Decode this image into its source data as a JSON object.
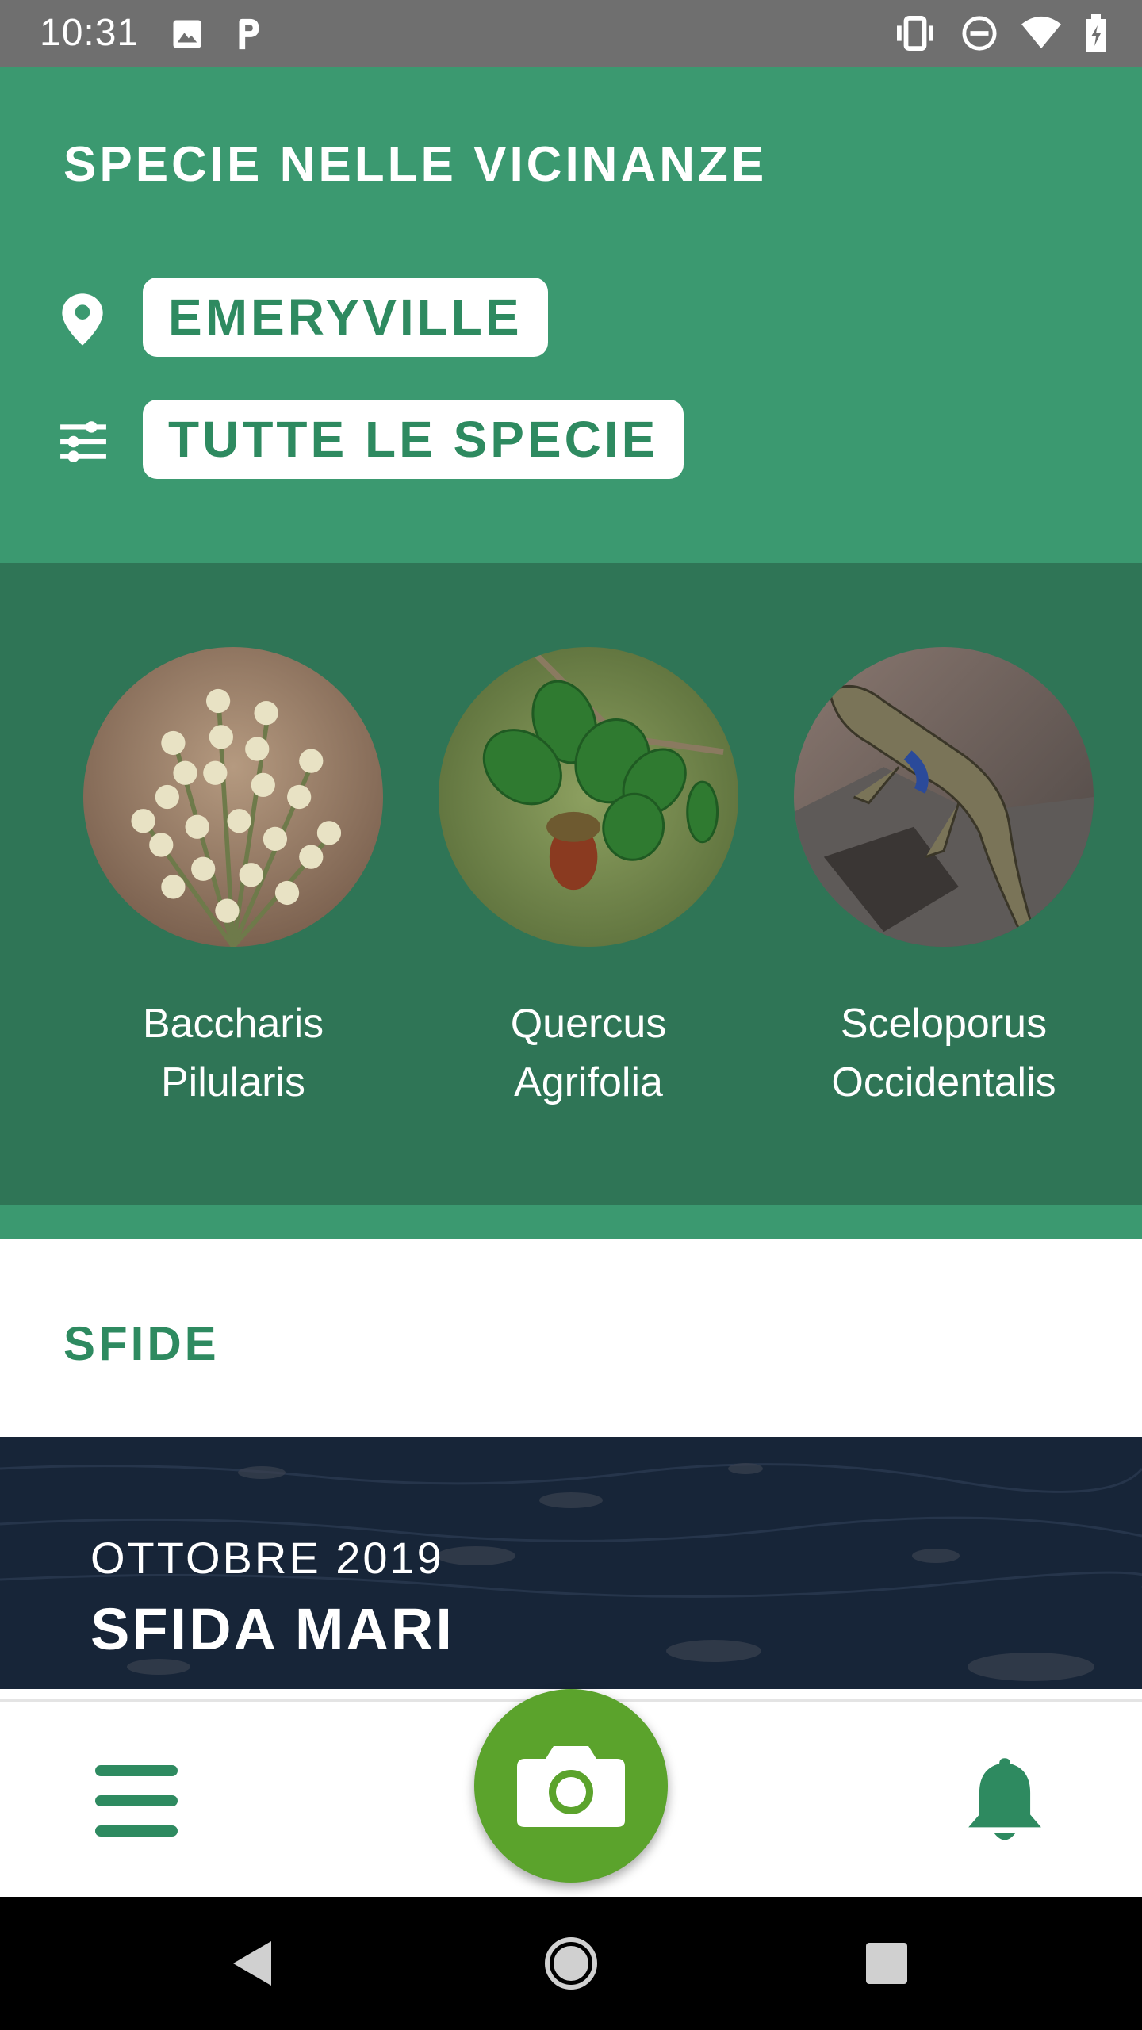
{
  "status_bar": {
    "time": "10:31",
    "left_icons": [
      "image-icon",
      "parking-icon"
    ],
    "right_icons": [
      "vibrate-icon",
      "do-not-disturb-icon",
      "wifi-icon",
      "battery-charging-icon"
    ]
  },
  "header": {
    "title": "SPECIE NELLE VICINANZE",
    "location_label": "EMERYVILLE",
    "location_icon": "location-pin-icon",
    "filter_label": "TUTTE LE SPECIE",
    "filter_icon": "filter-sliders-icon"
  },
  "species": [
    {
      "name_line1": "Baccharis",
      "name_line2": "Pilularis"
    },
    {
      "name_line1": "Quercus",
      "name_line2": "Agrifolia"
    },
    {
      "name_line1": "Sceloporus",
      "name_line2": "Occidentalis"
    }
  ],
  "challenges": {
    "section_title": "SFIDE",
    "card": {
      "date": "OTTOBRE 2019",
      "title": "SFIDA MARI"
    }
  },
  "bottom_nav": {
    "menu_icon": "hamburger-menu-icon",
    "camera_icon": "camera-icon",
    "notifications_icon": "bell-icon"
  },
  "colors": {
    "header_green": "#3b9970",
    "species_green": "#2f7556",
    "accent_green": "#2e8a60",
    "camera_green": "#5ba32c"
  }
}
